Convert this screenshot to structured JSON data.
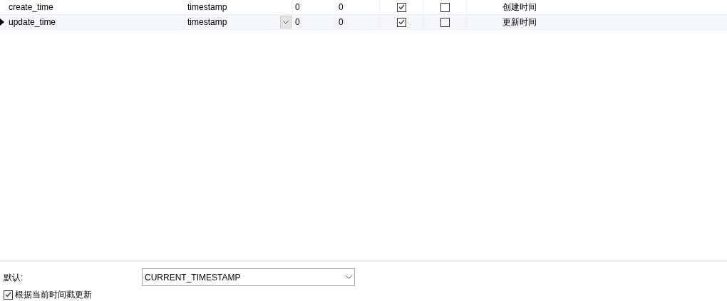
{
  "rows": [
    {
      "name": "create_time",
      "type": "timestamp",
      "length": "0",
      "decimals": "0",
      "not_null": true,
      "key": false,
      "comment": "创建时间",
      "selected": false
    },
    {
      "name": "update_time",
      "type": "timestamp",
      "length": "0",
      "decimals": "0",
      "not_null": true,
      "key": false,
      "comment": "更新时间",
      "selected": true
    }
  ],
  "default_label": "默认:",
  "default_value": "CURRENT_TIMESTAMP",
  "on_update": {
    "label": "根据当前时间戳更新",
    "checked": true
  }
}
